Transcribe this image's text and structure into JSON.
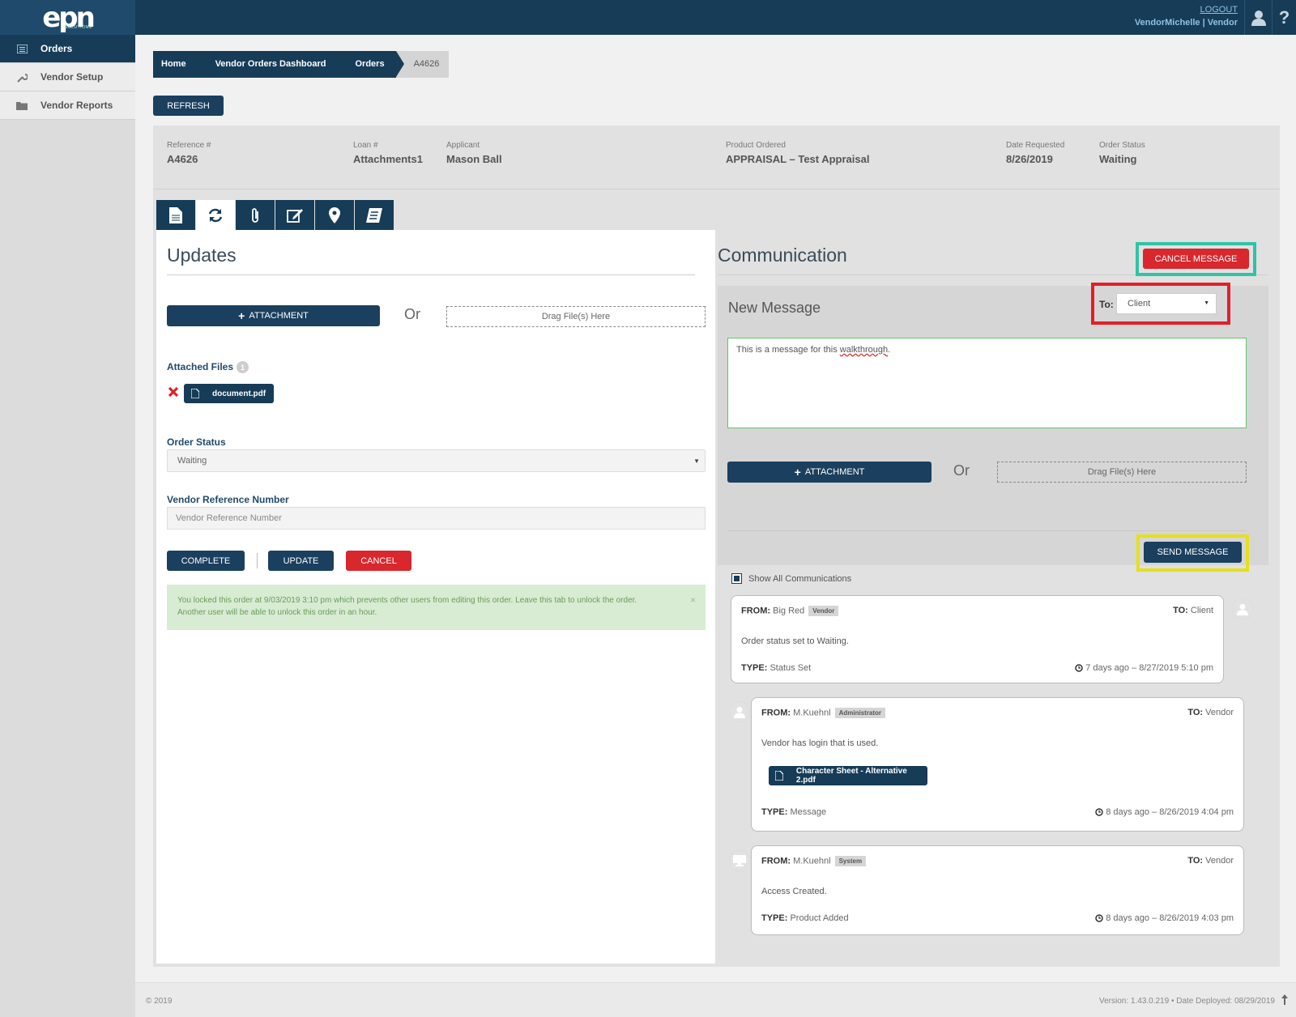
{
  "header": {
    "logo_text": "epn",
    "logo_sub": "SOLUTIONS",
    "logout_label": "LOGOUT",
    "user_line": "VendorMichelle | Vendor",
    "help_glyph": "?"
  },
  "sidebar": {
    "items": [
      {
        "label": "Orders",
        "icon": "list-icon",
        "active": true
      },
      {
        "label": "Vendor Setup",
        "icon": "wrench-icon",
        "active": false
      },
      {
        "label": "Vendor Reports",
        "icon": "folder-icon",
        "active": false
      }
    ]
  },
  "breadcrumb": [
    "Home",
    "Vendor Orders Dashboard",
    "Orders",
    "A4626"
  ],
  "refresh_label": "REFRESH",
  "order_info": {
    "reference": {
      "label": "Reference #",
      "value": "A4626"
    },
    "loan": {
      "label": "Loan #",
      "value": "Attachments1"
    },
    "applicant": {
      "label": "Applicant",
      "value": "Mason Ball"
    },
    "product": {
      "label": "Product Ordered",
      "value": "APPRAISAL – Test Appraisal"
    },
    "date_requested": {
      "label": "Date Requested",
      "value": "8/26/2019"
    },
    "order_status": {
      "label": "Order Status",
      "value": "Waiting"
    }
  },
  "tabs": [
    "document-icon",
    "refresh-icon",
    "paperclip-icon",
    "edit-icon",
    "map-pin-icon",
    "notes-icon"
  ],
  "updates": {
    "title": "Updates",
    "attachment_label": "ATTACHMENT",
    "or_label": "Or",
    "drop_label": "Drag File(s) Here",
    "attached_files_label": "Attached Files",
    "attached_count": "1",
    "file_name": "document.pdf",
    "order_status_label": "Order Status",
    "order_status_value": "Waiting",
    "vendor_ref_label": "Vendor Reference Number",
    "vendor_ref_placeholder": "Vendor Reference Number",
    "complete_label": "COMPLETE",
    "update_label": "UPDATE",
    "cancel_label": "CANCEL",
    "alert_line1": "You locked this order at 9/03/2019 3:10 pm which prevents other users from editing this order. Leave this tab to unlock the order.",
    "alert_line2": "Another user will be able to unlock this order in an hour.",
    "alert_close": "×"
  },
  "communication": {
    "title": "Communication",
    "cancel_message_label": "CANCEL MESSAGE",
    "new_message_label": "New Message",
    "to_label": "To:",
    "to_value": "Client",
    "message_text_before": "This is a message for this ",
    "message_text_spell": "walkthrough",
    "message_text_after": ".",
    "attachment_label": "ATTACHMENT",
    "or_label": "Or",
    "drop_label": "Drag File(s) Here",
    "send_label": "SEND MESSAGE",
    "show_all_label": "Show All Communications",
    "highlight_colors": {
      "cancel": "#2ec4a5",
      "to": "#e0202a",
      "send": "#e6e01c"
    },
    "entries": [
      {
        "from_label": "FROM:",
        "from": "Big Red",
        "role": "Vendor",
        "to_label": "TO:",
        "to": "Client",
        "body": "Order status set to Waiting.",
        "type_label": "TYPE:",
        "type": "Status Set",
        "time": "7 days ago – 8/27/2019 5:10 pm"
      },
      {
        "from_label": "FROM:",
        "from": "M.Kuehnl",
        "role": "Administrator",
        "to_label": "TO:",
        "to": "Vendor",
        "body": "Vendor has login that is used.",
        "attachment": "Character Sheet - Alternative 2.pdf",
        "type_label": "TYPE:",
        "type": "Message",
        "time": "8 days ago – 8/26/2019 4:04 pm"
      },
      {
        "from_label": "FROM:",
        "from": "M.Kuehnl",
        "role": "System",
        "to_label": "TO:",
        "to": "Vendor",
        "body": "Access Created.",
        "type_label": "TYPE:",
        "type": "Product Added",
        "time": "8 days ago – 8/26/2019 4:03 pm"
      }
    ]
  },
  "footer": {
    "copyright": "© 2019",
    "version": "Version: 1.43.0.219  •  Date Deployed: 08/29/2019"
  }
}
